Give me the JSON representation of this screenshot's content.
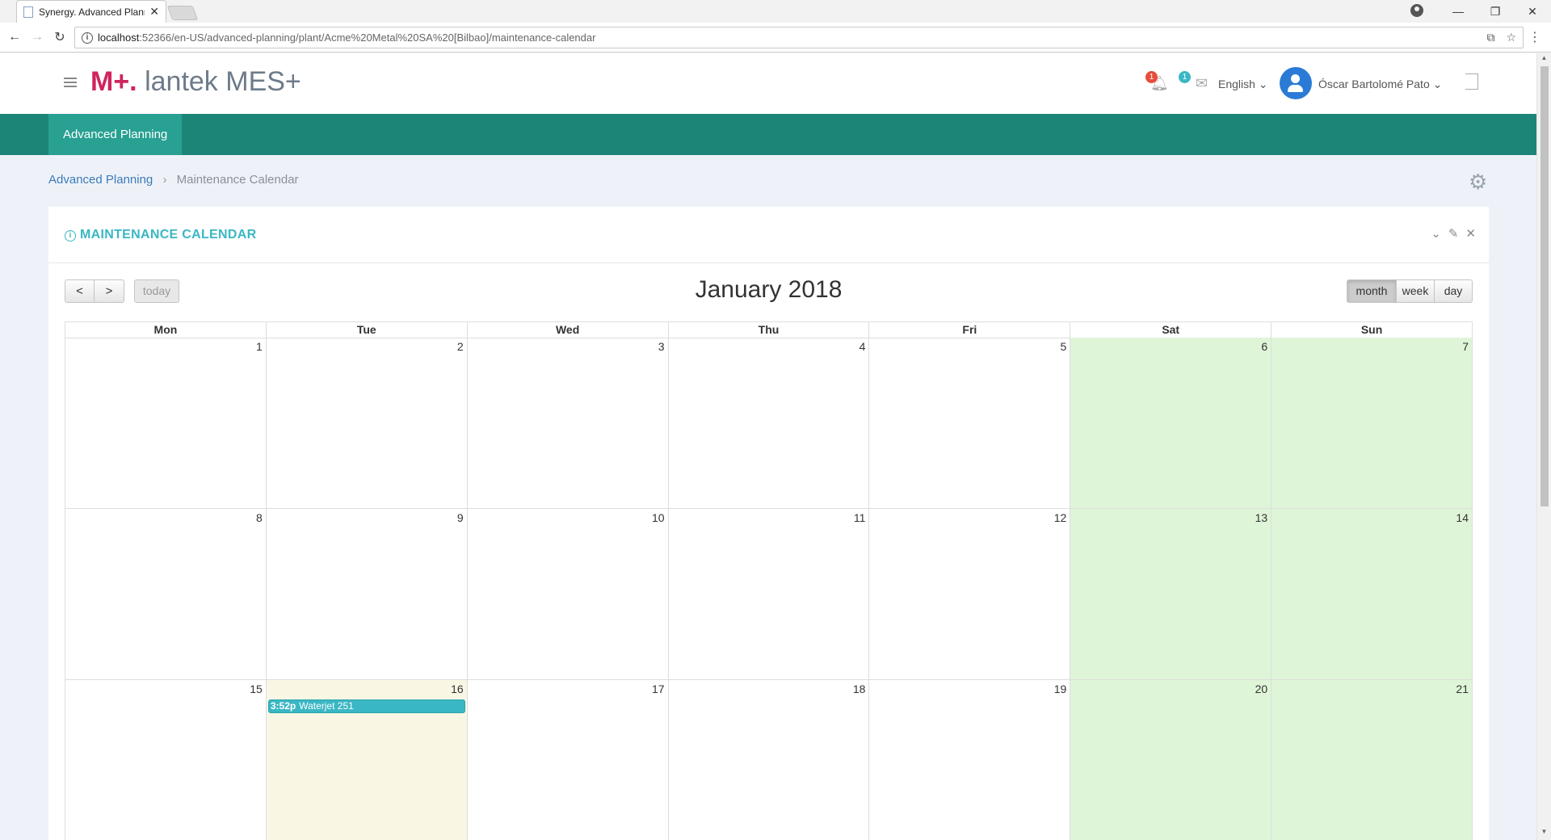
{
  "browser": {
    "tab_title": "Synergy. Advanced Planni",
    "tab_close": "✕",
    "url_host": "localhost",
    "url_path": ":52366/en-US/advanced-planning/plant/Acme%20Metal%20SA%20[Bilbao]/maintenance-calendar",
    "back": "←",
    "forward": "→",
    "reload": "↻",
    "minimize": "—",
    "restore": "❐",
    "close": "✕",
    "translate": "⧉",
    "bookmark": "☆",
    "menu": "⋮"
  },
  "header": {
    "logo_mark": "M+.",
    "logo_text": " lantek MES+",
    "notifications_count": "1",
    "messages_count": "1",
    "bell": "🔔︎",
    "envelope": "✉",
    "language": "English ⌄",
    "user_name": "Óscar Bartolomé Pato ⌄"
  },
  "nav": {
    "items": [
      {
        "label": "Advanced Planning"
      }
    ]
  },
  "breadcrumb": {
    "parent": "Advanced Planning",
    "separator": "›",
    "current": "Maintenance Calendar",
    "settings": "⚙"
  },
  "panel": {
    "info": "i",
    "title": "MAINTENANCE CALENDAR",
    "collapse": "⌄",
    "wrench": "✎",
    "close": "✕"
  },
  "calendar": {
    "title": "January 2018",
    "prev": "<",
    "next": ">",
    "today_label": "today",
    "views": {
      "month": "month",
      "week": "week",
      "day": "day"
    },
    "active_view": "month",
    "days_of_week": [
      "Mon",
      "Tue",
      "Wed",
      "Thu",
      "Fri",
      "Sat",
      "Sun"
    ],
    "weeks": [
      [
        "1",
        "2",
        "3",
        "4",
        "5",
        "6",
        "7"
      ],
      [
        "8",
        "9",
        "10",
        "11",
        "12",
        "13",
        "14"
      ],
      [
        "15",
        "16",
        "17",
        "18",
        "19",
        "20",
        "21"
      ]
    ],
    "today_date": "16",
    "event": {
      "time": "3:52p",
      "title": "Waterjet 251",
      "date": "16"
    },
    "colors": {
      "weekend": "#dff5d8",
      "today": "#f9f7e4",
      "event": "#3ab7c4",
      "nav": "#1d8578"
    }
  }
}
